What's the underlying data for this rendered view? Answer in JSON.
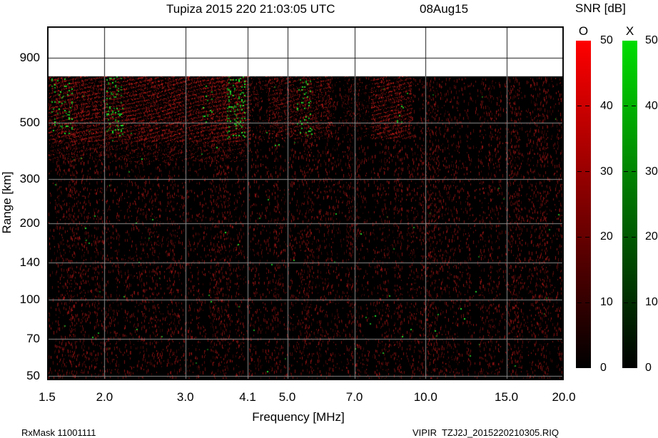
{
  "title": {
    "main": "Tupiza 2015 220 21:03:05 UTC",
    "date": "08Aug15"
  },
  "footer": {
    "left": "RxMask 11001111",
    "right": "VIPIR  TZJ2J_2015220210305.RIQ"
  },
  "chart_data": {
    "type": "heatmap",
    "title": "Tupiza 2015 220 21:03:05 UTC",
    "subtitle_date": "08Aug15",
    "xlabel": "Frequency [MHz]",
    "ylabel": "Range [km]",
    "x_scale": "log",
    "y_scale": "log",
    "xlim_mhz": [
      1.5,
      20.0
    ],
    "ylim_km": [
      48,
      1200
    ],
    "grid": true,
    "x_ticks": [
      {
        "value": 1.5,
        "label": "1.5"
      },
      {
        "value": 2.0,
        "label": "2.0"
      },
      {
        "value": 3.0,
        "label": "3.0"
      },
      {
        "value": 4.1,
        "label": "4.1"
      },
      {
        "value": 5.0,
        "label": "5.0"
      },
      {
        "value": 7.0,
        "label": "7.0"
      },
      {
        "value": 10.0,
        "label": "10.0"
      },
      {
        "value": 15.0,
        "label": "15.0"
      },
      {
        "value": 20.0,
        "label": "20.0"
      }
    ],
    "y_ticks": [
      {
        "value": 50,
        "label": "50"
      },
      {
        "value": 70,
        "label": "70"
      },
      {
        "value": 100,
        "label": "100"
      },
      {
        "value": 140,
        "label": "140"
      },
      {
        "value": 200,
        "label": "200"
      },
      {
        "value": 300,
        "label": "300"
      },
      {
        "value": 500,
        "label": "500"
      },
      {
        "value": 900,
        "label": "900"
      }
    ],
    "data_top_km": 760,
    "background_color": "#000000",
    "o_mode_color": "#c81e1e",
    "x_mode_color": "#22cc22",
    "noise": {
      "density": 0.05,
      "dash_min": 2,
      "dash_max": 5,
      "green_dot_rate": 0.0015
    },
    "echo_layers": [
      {
        "f0": 1.5,
        "f1": 4.5,
        "r0": 420,
        "r1": 760,
        "intensity": 1.0
      },
      {
        "f0": 4.5,
        "f1": 6.25,
        "r0": 430,
        "r1": 760,
        "intensity": 0.62
      },
      {
        "f0": 6.25,
        "f1": 7.6,
        "r0": 440,
        "r1": 760,
        "intensity": 0.3
      },
      {
        "f0": 7.6,
        "f1": 9.35,
        "r0": 430,
        "r1": 760,
        "intensity": 0.85
      },
      {
        "f0": 1.5,
        "f1": 4.2,
        "r0": 350,
        "r1": 420,
        "intensity": 0.45
      }
    ],
    "echo_notches": [
      [
        4.15,
        4.55
      ],
      [
        6.35,
        6.6
      ]
    ],
    "x_mode_clusters": [
      {
        "f0": 1.53,
        "f1": 1.7,
        "r0": 450,
        "r1": 745,
        "density": 0.1
      },
      {
        "f0": 2.02,
        "f1": 2.2,
        "r0": 430,
        "r1": 760,
        "density": 0.12
      },
      {
        "f0": 3.25,
        "f1": 3.55,
        "r0": 470,
        "r1": 700,
        "density": 0.035
      },
      {
        "f0": 3.7,
        "f1": 4.05,
        "r0": 430,
        "r1": 760,
        "density": 0.1
      },
      {
        "f0": 5.25,
        "f1": 5.65,
        "r0": 440,
        "r1": 740,
        "density": 0.085
      },
      {
        "f0": 8.6,
        "f1": 9.15,
        "r0": 460,
        "r1": 700,
        "density": 0.022
      }
    ],
    "colorbar": {
      "title": "SNR [dB]",
      "min": 0,
      "max": 50,
      "ticks": [
        {
          "value": 0,
          "label": "0"
        },
        {
          "value": 10,
          "label": "10"
        },
        {
          "value": 20,
          "label": "20"
        },
        {
          "value": 30,
          "label": "30"
        },
        {
          "value": 40,
          "label": "40"
        },
        {
          "value": 50,
          "label": "50"
        }
      ],
      "bars": [
        {
          "label": "O",
          "top_color": "#ff0000"
        },
        {
          "label": "X",
          "top_color": "#00dd00"
        }
      ]
    }
  }
}
